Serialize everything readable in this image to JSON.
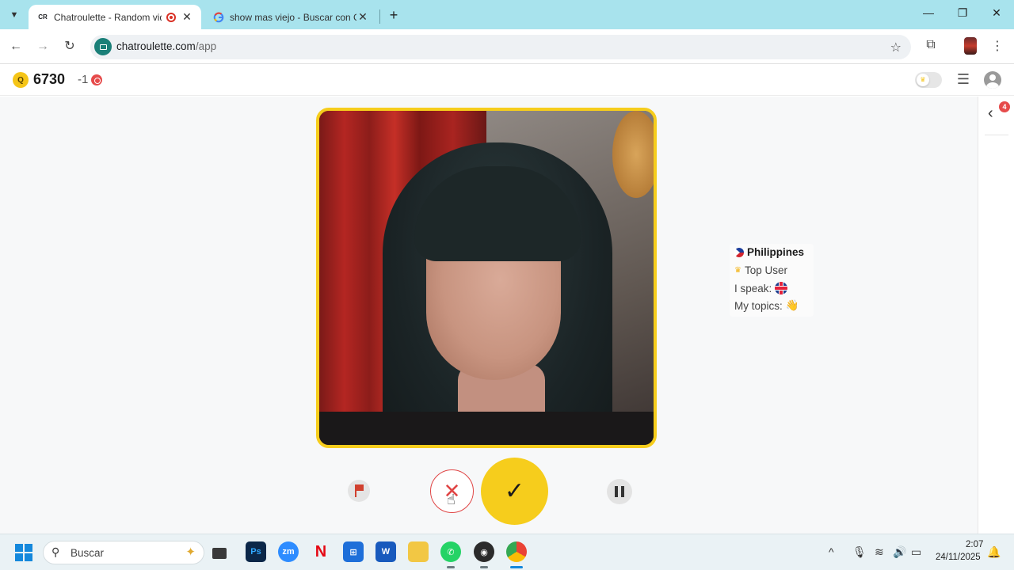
{
  "browser": {
    "tabs": [
      {
        "favicon": "CR",
        "title": "Chatroulette - Random vide",
        "recording": true
      },
      {
        "favicon": "G",
        "title": "show mas viejo - Buscar con Go",
        "recording": false
      }
    ],
    "url_host": "chatroulette.com",
    "url_path": "/app",
    "colors": {
      "tabstrip": "#a8e3ed",
      "site_icon": "#1a7f78"
    }
  },
  "app": {
    "coins_icon": "Q",
    "coins": "6730",
    "minus_count": "-1",
    "notification_count": "4",
    "colors": {
      "accent": "#f6cd1c",
      "danger": "#e04545"
    }
  },
  "partner": {
    "country": "Philippines",
    "badge": "Top User",
    "speak_label": "I speak:",
    "topics_label": "My topics:",
    "topics_emoji": "👋"
  },
  "controls": {
    "report_icon": "flag-icon",
    "skip_icon": "close-icon",
    "accept_icon": "check-icon",
    "pause_icon": "pause-icon"
  },
  "taskbar": {
    "search_placeholder": "Buscar",
    "apps": [
      {
        "name": "task-view",
        "label": ""
      },
      {
        "name": "photoshop",
        "label": "Ps"
      },
      {
        "name": "zoom",
        "label": "zm"
      },
      {
        "name": "netflix",
        "label": "N"
      },
      {
        "name": "store",
        "label": ""
      },
      {
        "name": "word",
        "label": "W"
      },
      {
        "name": "file-explorer",
        "label": ""
      },
      {
        "name": "whatsapp",
        "label": ""
      },
      {
        "name": "obs",
        "label": ""
      },
      {
        "name": "chrome",
        "label": ""
      }
    ],
    "time": "2:07",
    "date": "24/11/2025"
  }
}
